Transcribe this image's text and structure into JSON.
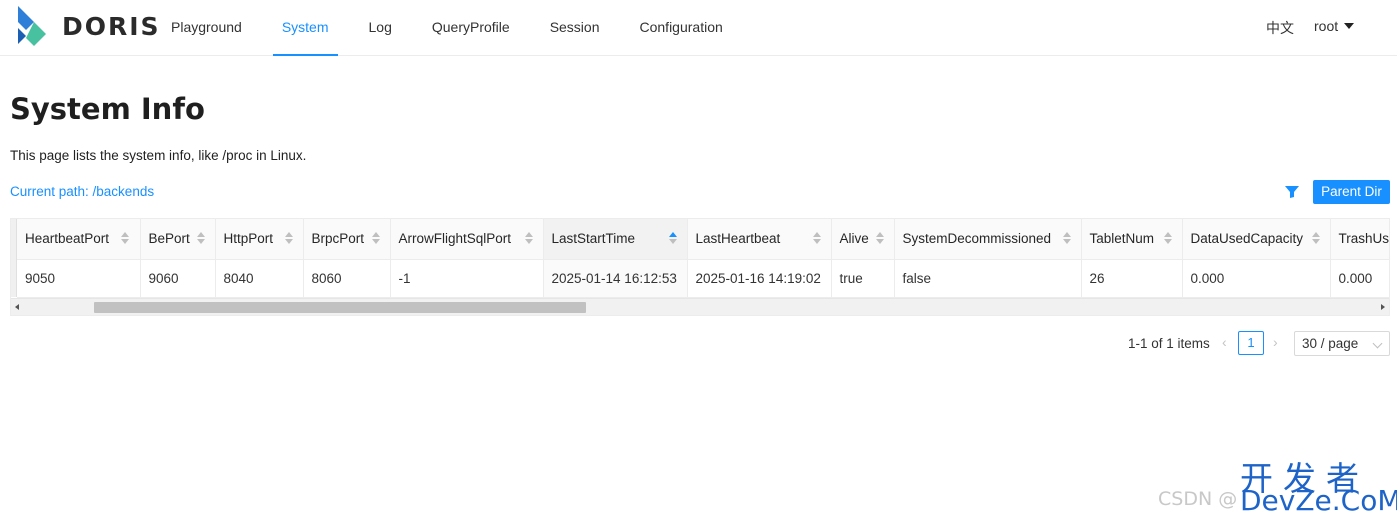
{
  "header": {
    "brand": "DORIS",
    "nav": [
      {
        "label": "Playground"
      },
      {
        "label": "System",
        "active": true
      },
      {
        "label": "Log"
      },
      {
        "label": "QueryProfile"
      },
      {
        "label": "Session"
      },
      {
        "label": "Configuration"
      }
    ],
    "language": "中文",
    "user": "root"
  },
  "page": {
    "title": "System Info",
    "description": "This page lists the system info, like /proc in Linux.",
    "current_path": "Current path: /backends",
    "parent_dir_label": "Parent Dir"
  },
  "table": {
    "columns": [
      "HeartbeatPort",
      "BePort",
      "HttpPort",
      "BrpcPort",
      "ArrowFlightSqlPort",
      "LastStartTime",
      "LastHeartbeat",
      "Alive",
      "SystemDecommissioned",
      "TabletNum",
      "DataUsedCapacity",
      "TrashUse"
    ],
    "sorted_column": "LastStartTime",
    "rows": [
      [
        "9050",
        "9060",
        "8040",
        "8060",
        "-1",
        "2025-01-14 16:12:53",
        "2025-01-16 14:19:02",
        "true",
        "false",
        "26",
        "0.000",
        "0.000"
      ]
    ]
  },
  "pagination": {
    "total": "1-1 of 1 items",
    "current_page": "1",
    "page_size": "30 / page"
  },
  "watermark": {
    "csdn": "CSDN @",
    "site_cn": "开发者",
    "site_en": "DevZe.CoM"
  },
  "colors": {
    "accent": "#1890ff",
    "logo_top": "#2f7fd8",
    "logo_bottom": "#47c1a0"
  }
}
